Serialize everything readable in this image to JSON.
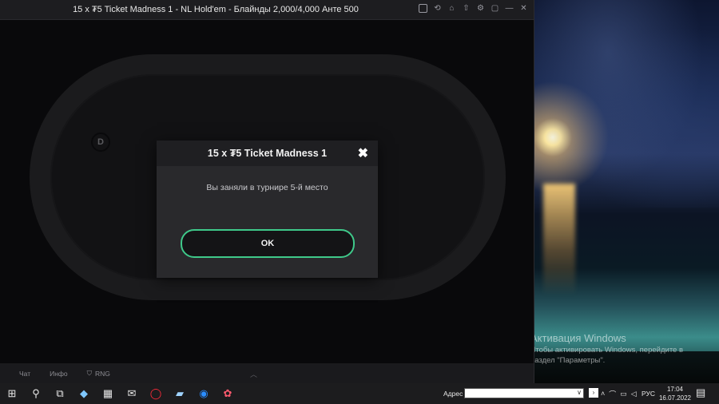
{
  "window": {
    "title": "15 x ₮5 Ticket Madness 1 - NL Hold'em - Блайнды 2,000/4,000 Анте 500",
    "icons": [
      "layout-icon",
      "history-icon",
      "lobby-icon",
      "export-icon",
      "settings-icon",
      "chat-icon",
      "minimize-icon",
      "close-icon"
    ]
  },
  "table": {
    "dealer_label": "D"
  },
  "modal": {
    "title": "15 x ₮5 Ticket Madness 1",
    "close_glyph": "✖",
    "message": "Вы заняли в турнире 5-й место",
    "ok_label": "OK",
    "accent_color": "#3fc98a"
  },
  "bottom_bar": {
    "chat_label": "Чат",
    "info_label": "Инфо",
    "rng_label": "RNG"
  },
  "activation": {
    "title": "Активация Windows",
    "line1": "Чтобы активировать Windows, перейдите в",
    "line2": "раздел \"Параметры\"."
  },
  "taskbar": {
    "address_label": "Адрес",
    "address_value": "",
    "language": "РУС",
    "time": "17:04",
    "date": "16.07.2022"
  }
}
